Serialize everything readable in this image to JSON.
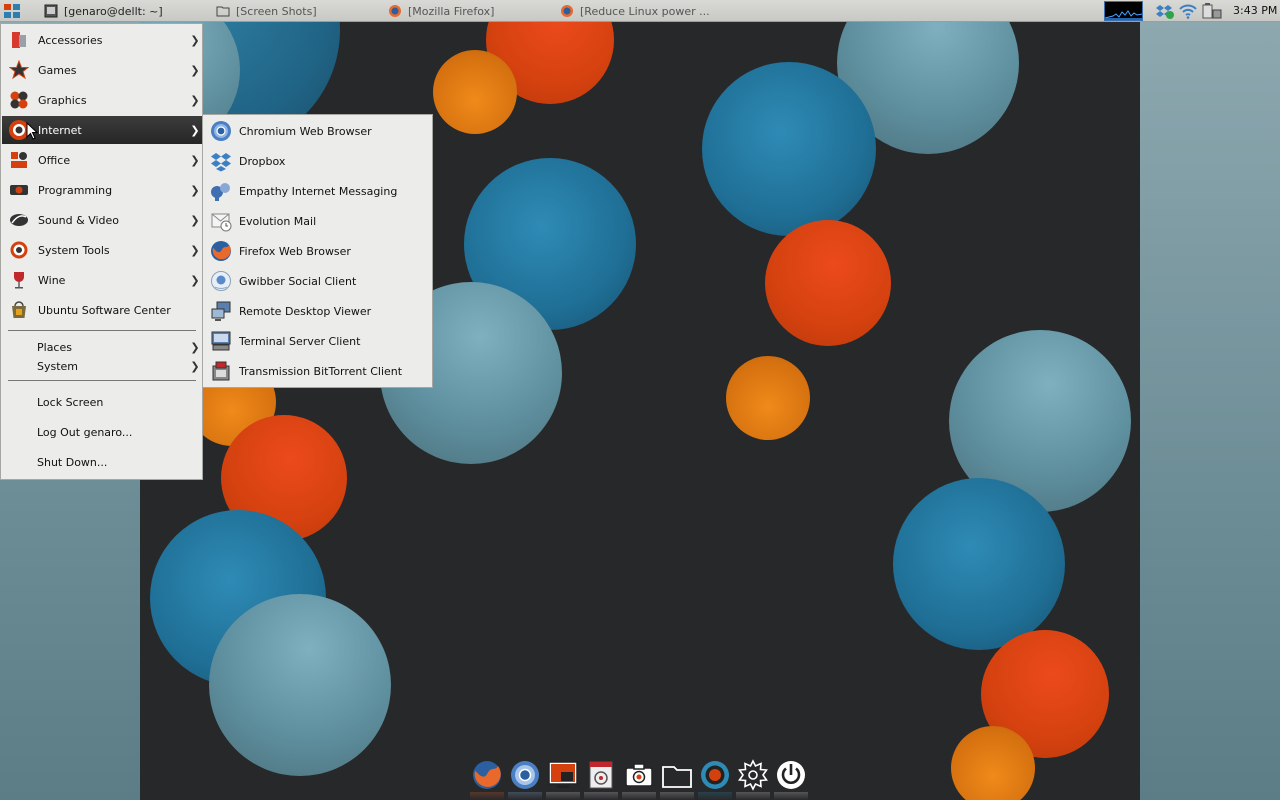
{
  "top_panel": {
    "tasks": [
      {
        "label": "[genaro@dellt: ~]"
      },
      {
        "label": "[Screen Shots]"
      },
      {
        "label": "[Mozilla Firefox]"
      },
      {
        "label": "[Reduce Linux power ..."
      }
    ],
    "clock": "3:43 PM"
  },
  "main_menu": {
    "categories": [
      {
        "label": "Accessories",
        "icon": "accessories-icon"
      },
      {
        "label": "Games",
        "icon": "games-icon"
      },
      {
        "label": "Graphics",
        "icon": "graphics-icon"
      },
      {
        "label": "Internet",
        "icon": "internet-icon"
      },
      {
        "label": "Office",
        "icon": "office-icon"
      },
      {
        "label": "Programming",
        "icon": "programming-icon"
      },
      {
        "label": "Sound & Video",
        "icon": "sound-video-icon"
      },
      {
        "label": "System Tools",
        "icon": "system-tools-icon"
      },
      {
        "label": "Wine",
        "icon": "wine-icon"
      },
      {
        "label": "Ubuntu Software Center",
        "icon": "software-center-icon"
      }
    ],
    "places": "Places",
    "system": "System",
    "lock_screen": "Lock Screen",
    "log_out": "Log Out genaro...",
    "shut_down": "Shut Down..."
  },
  "internet_submenu": {
    "items": [
      {
        "label": "Chromium Web Browser",
        "icon": "chromium-icon"
      },
      {
        "label": "Dropbox",
        "icon": "dropbox-icon"
      },
      {
        "label": "Empathy Internet Messaging",
        "icon": "empathy-icon"
      },
      {
        "label": "Evolution Mail",
        "icon": "evolution-icon"
      },
      {
        "label": "Firefox Web Browser",
        "icon": "firefox-icon"
      },
      {
        "label": "Gwibber Social Client",
        "icon": "gwibber-icon"
      },
      {
        "label": "Remote Desktop Viewer",
        "icon": "remote-desktop-icon"
      },
      {
        "label": "Terminal Server Client",
        "icon": "terminal-server-icon"
      },
      {
        "label": "Transmission BitTorrent Client",
        "icon": "transmission-icon"
      }
    ]
  },
  "dock": {
    "items": [
      "firefox-icon",
      "chromium-icon",
      "terminal-icon",
      "media-player-icon",
      "camera-icon",
      "folder-icon",
      "target-icon",
      "settings-gear-icon",
      "power-icon"
    ]
  },
  "colors": {
    "wallpaper": "#27282a",
    "menu_bg": "#ececea",
    "menu_active": "#2e2e2e",
    "bubble_orange": "#d4410f",
    "bubble_blue": "#1f6f96",
    "bubble_pale": "#5e8f9e"
  }
}
